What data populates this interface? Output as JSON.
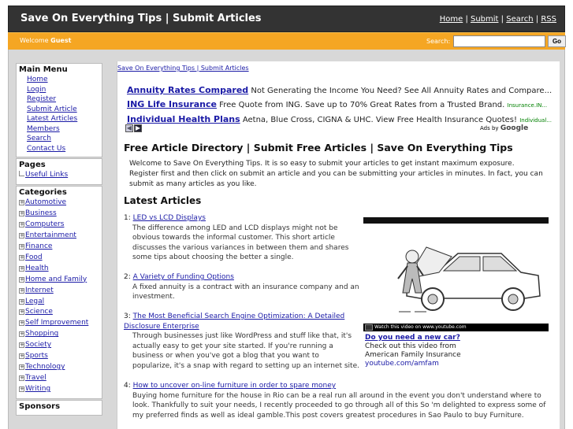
{
  "header": {
    "title": "Save On Everything Tips | Submit Articles",
    "nav": [
      "Home",
      "Submit",
      "Search",
      "RSS"
    ],
    "separator": "|"
  },
  "bar": {
    "welcome_prefix": "Welcome",
    "welcome_user": "Guest",
    "search_label": "Search:",
    "search_value": "",
    "go_label": "Go"
  },
  "sidebar": {
    "main_menu": {
      "title": "Main Menu",
      "items": [
        "Home",
        "Login",
        "Register",
        "Submit Article",
        "Latest Articles",
        "Members",
        "Search",
        "Contact Us"
      ]
    },
    "pages": {
      "title": "Pages",
      "items": [
        "Useful Links"
      ]
    },
    "categories": {
      "title": "Categories",
      "items": [
        "Automotive",
        "Business",
        "Computers",
        "Entertainment",
        "Finance",
        "Food",
        "Health",
        "Home and Family",
        "Internet",
        "Legal",
        "Science",
        "Self Improvement",
        "Shopping",
        "Society",
        "Sports",
        "Technology",
        "Travel",
        "Writing"
      ]
    },
    "sponsors_title": "Sponsors"
  },
  "content": {
    "breadcrumb": "Save On Everything Tips | Submit Articles",
    "ads": [
      {
        "title": "Annuity Rates Compared",
        "text": "Not Generating the Income You Need? See All Annuity Rates and Compare...",
        "url": ""
      },
      {
        "title": "ING Life Insurance",
        "text": "Free Quote from ING. Save up to 70% Great Rates from a Trusted Brand.",
        "url": "Insurance.IN..."
      },
      {
        "title": "Individual Health Plans",
        "text": "Aetna, Blue Cross, CIGNA & UHC. View Free Health Insurance Quotes!",
        "url": "Individual..."
      }
    ],
    "ads_by": "Ads by",
    "ads_brand": "Google",
    "page_title": "Free Article Directory | Submit Free Articles | Save On Everything Tips",
    "intro": "Welcome to Save On Everything Tips. It is so easy to submit your articles to get instant maximum exposure. Register first and then click on submit an article and you can be submitting your articles in minutes. In fact, you can submit as many articles as you like.",
    "latest_heading": "Latest Articles",
    "articles": [
      {
        "num": "1:",
        "title": "LED vs LCD Displays",
        "desc": "The difference among LED and LCD displays might not be obvious towards the informal customer. This short article discusses the various variances in between them and shares some tips about choosing the better a single."
      },
      {
        "num": "2:",
        "title": "A Variety of Funding Options",
        "desc": "A fixed annuity is a contract with an insurance company and an investment."
      },
      {
        "num": "3:",
        "title": "The Most Beneficial Search Engine Optimization: A Detailed Disclosure Enterprise",
        "desc": "Through businesses just like WordPress and stuff like that, it's actually easy to get your site started. If you're running a business or when you've got a blog that you want to popularize, it's a snap with regard to setting up an internet site."
      },
      {
        "num": "4:",
        "title": "How to uncover on-line furniture in order to spare money",
        "desc": "Buying home furniture for the house in Rio can be a real run all around in the event you don't understand where to look. Thankfully to suit your needs, I recently proceeded to go through all of this So 'm delighted to express some of my preferred finds as well as ideal gamble.This post covers greatest procedures in Sao Paulo to buy Furniture."
      }
    ],
    "video": {
      "bar_text": "Watch this video on www.youtube.com",
      "title": "Do you need a new car?",
      "line1": "Check out this video from",
      "line2": "American Family Insurance",
      "url": "youtube.com/amfam"
    }
  }
}
